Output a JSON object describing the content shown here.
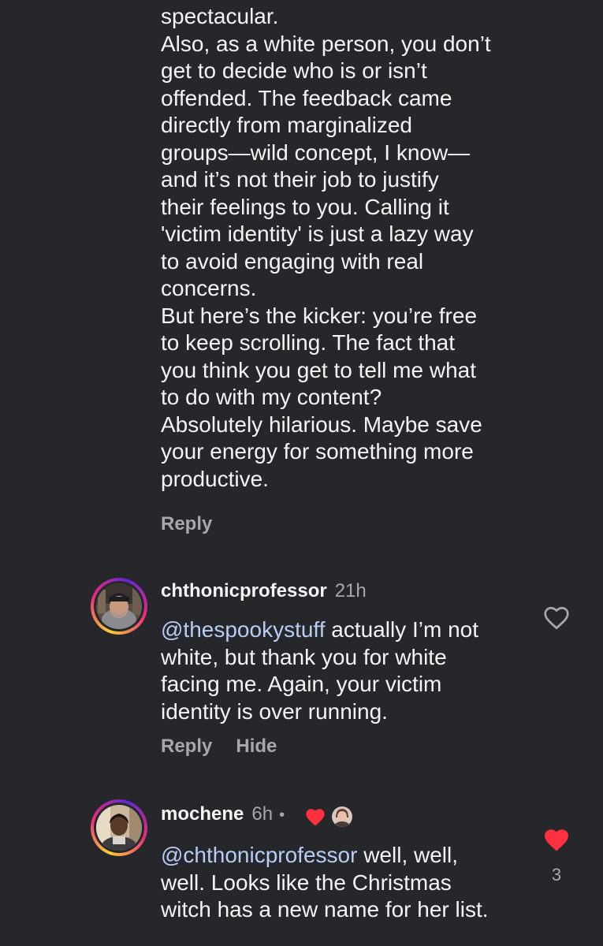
{
  "parent_comment": {
    "continued_lines": [
      "spectacular.",
      "Also, as a white person, you don’t",
      "get to decide who is or isn’t",
      "offended. The feedback came",
      "directly from marginalized",
      "groups—wild concept, I know—",
      "and it’s not their job to justify",
      "their feelings to you. Calling it",
      "'victim identity' is just a lazy way",
      "to avoid engaging with real",
      "concerns.",
      "But here’s the kicker: you’re free",
      "to keep scrolling. The fact that",
      "you think you get to tell me what",
      "to do with my content?",
      "Absolutely hilarious. Maybe save",
      "your energy for something more",
      "productive."
    ],
    "reply_label": "Reply"
  },
  "comments": [
    {
      "username": "chthonicprofessor",
      "time": "21h",
      "mention": "@thespookystuff",
      "lines": [
        " actually I’m not",
        "white, but thank you for white",
        "facing me. Again, your victim",
        "identity is over running."
      ],
      "reply_label": "Reply",
      "hide_label": "Hide",
      "liked": false,
      "icon": "heart-outline-icon"
    },
    {
      "username": "mochene",
      "time": "6h",
      "separator": "•",
      "creator_liked": true,
      "mention": "@chthonicprofessor",
      "lines": [
        " well, well,",
        "well. Looks like the Christmas",
        "witch has a new name for her list."
      ],
      "liked": true,
      "like_count": "3",
      "icon": "heart-filled-icon"
    }
  ],
  "colors": {
    "background": "#25272b",
    "text": "#f4f4f4",
    "muted": "#a8a8ab",
    "mention": "#b9ccf3",
    "like": "#ff3040"
  }
}
